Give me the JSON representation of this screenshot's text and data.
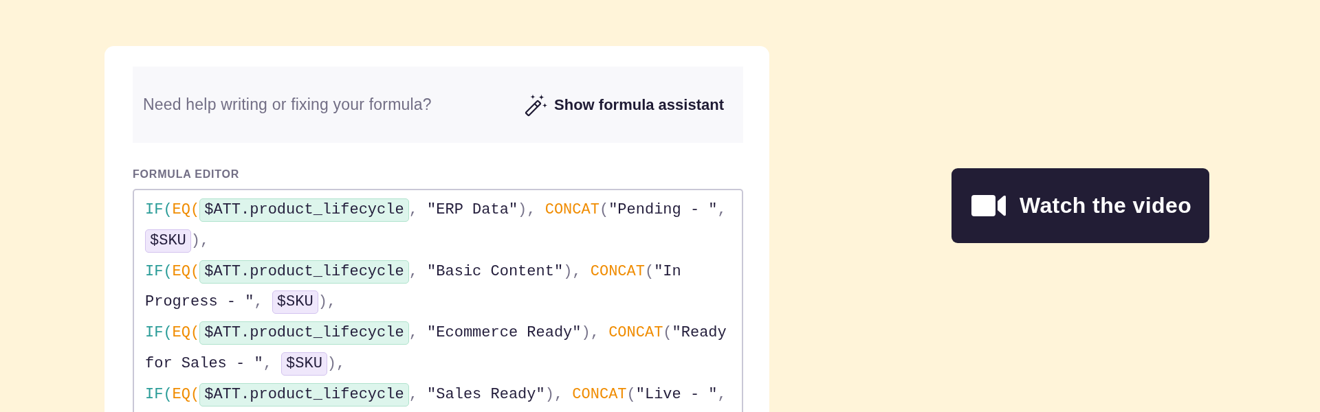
{
  "help_banner": {
    "text": "Need help writing or fixing your formula?",
    "assistant_button": "Show formula assistant"
  },
  "formula_editor": {
    "label": "FORMULA EDITOR",
    "lines": [
      {
        "tokens": [
          {
            "kind": "keyword",
            "text": "IF("
          },
          {
            "kind": "function",
            "text": "EQ("
          },
          {
            "kind": "attribute",
            "text": "$ATT.product_lifecycle"
          },
          {
            "kind": "punct",
            "text": ", "
          },
          {
            "kind": "string",
            "text": "\"ERP Data\""
          },
          {
            "kind": "punct",
            "text": "), "
          },
          {
            "kind": "function",
            "text": "CONCAT"
          },
          {
            "kind": "punct",
            "text": "("
          },
          {
            "kind": "string",
            "text": "\"Pending - \""
          },
          {
            "kind": "punct",
            "text": ","
          }
        ]
      },
      {
        "tokens": [
          {
            "kind": "variable",
            "text": "$SKU"
          },
          {
            "kind": "punct",
            "text": "),"
          }
        ]
      },
      {
        "tokens": [
          {
            "kind": "keyword",
            "text": "IF("
          },
          {
            "kind": "function",
            "text": "EQ("
          },
          {
            "kind": "attribute",
            "text": "$ATT.product_lifecycle"
          },
          {
            "kind": "punct",
            "text": ", "
          },
          {
            "kind": "string",
            "text": "\"Basic Content\""
          },
          {
            "kind": "punct",
            "text": "), "
          },
          {
            "kind": "function",
            "text": "CONCAT"
          },
          {
            "kind": "punct",
            "text": "("
          },
          {
            "kind": "string",
            "text": "\"In"
          }
        ]
      },
      {
        "tokens": [
          {
            "kind": "string",
            "text": "Progress - \""
          },
          {
            "kind": "punct",
            "text": ", "
          },
          {
            "kind": "variable",
            "text": "$SKU"
          },
          {
            "kind": "punct",
            "text": "),"
          }
        ]
      },
      {
        "tokens": [
          {
            "kind": "keyword",
            "text": "IF("
          },
          {
            "kind": "function",
            "text": "EQ("
          },
          {
            "kind": "attribute",
            "text": "$ATT.product_lifecycle"
          },
          {
            "kind": "punct",
            "text": ", "
          },
          {
            "kind": "string",
            "text": "\"Ecommerce Ready\""
          },
          {
            "kind": "punct",
            "text": "), "
          },
          {
            "kind": "function",
            "text": "CONCAT"
          },
          {
            "kind": "punct",
            "text": "("
          },
          {
            "kind": "string",
            "text": "\"Ready"
          }
        ]
      },
      {
        "tokens": [
          {
            "kind": "string",
            "text": "for Sales - \""
          },
          {
            "kind": "punct",
            "text": ", "
          },
          {
            "kind": "variable",
            "text": "$SKU"
          },
          {
            "kind": "punct",
            "text": "),"
          }
        ]
      },
      {
        "tokens": [
          {
            "kind": "keyword",
            "text": "IF("
          },
          {
            "kind": "function",
            "text": "EQ("
          },
          {
            "kind": "attribute",
            "text": "$ATT.product_lifecycle"
          },
          {
            "kind": "punct",
            "text": ", "
          },
          {
            "kind": "string",
            "text": "\"Sales Ready\""
          },
          {
            "kind": "punct",
            "text": "), "
          },
          {
            "kind": "function",
            "text": "CONCAT"
          },
          {
            "kind": "punct",
            "text": "("
          },
          {
            "kind": "string",
            "text": "\"Live - \""
          },
          {
            "kind": "punct",
            "text": ","
          }
        ]
      }
    ]
  },
  "video_button": {
    "label": "Watch the video"
  }
}
